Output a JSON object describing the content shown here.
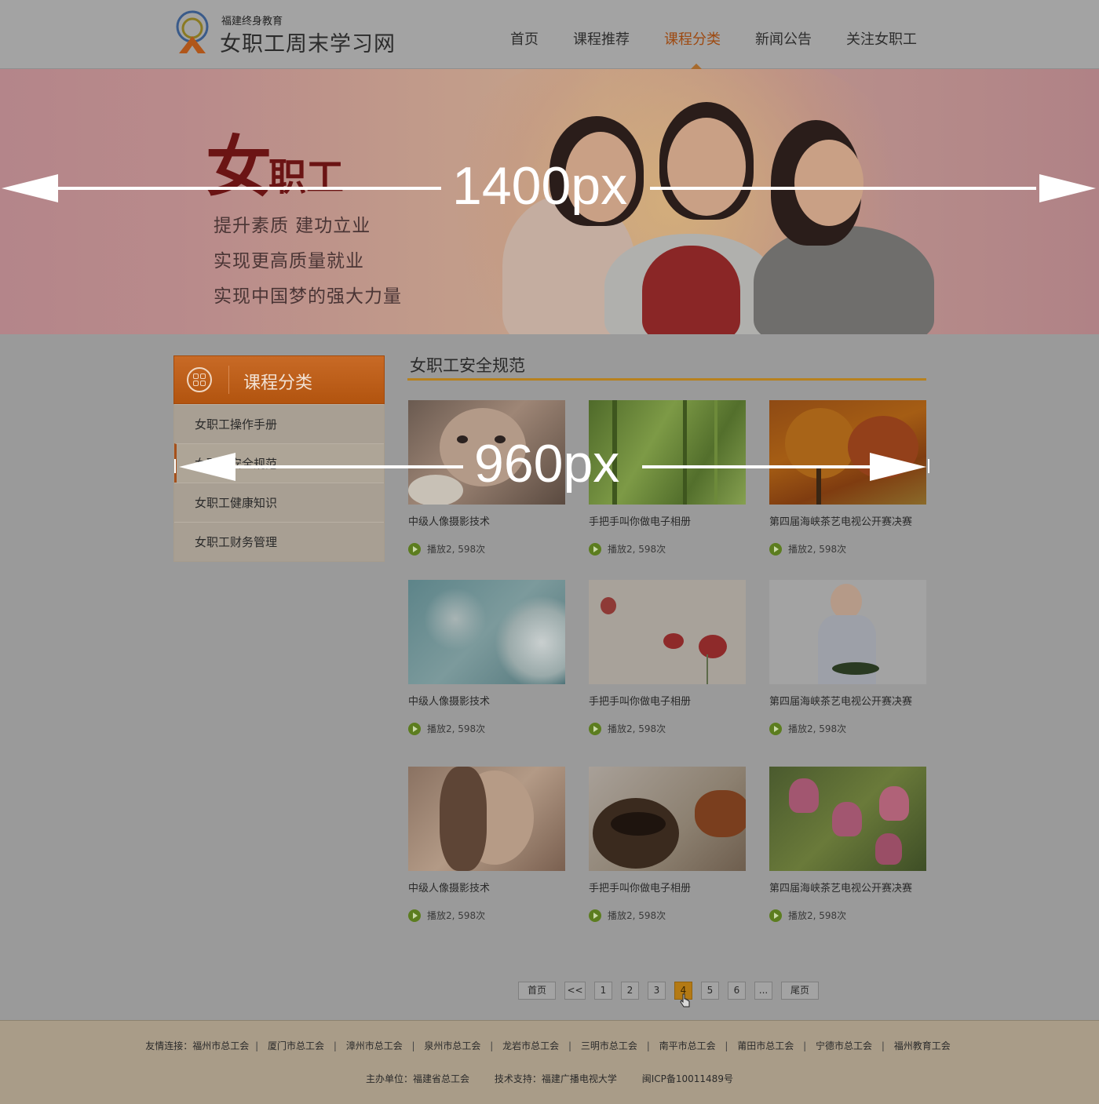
{
  "header": {
    "logo_sub": "福建终身教育",
    "logo_title": "女职工周末学习网",
    "nav": [
      {
        "label": "首页",
        "active": false
      },
      {
        "label": "课程推荐",
        "active": false
      },
      {
        "label": "课程分类",
        "active": true
      },
      {
        "label": "新闻公告",
        "active": false
      },
      {
        "label": "关注女职工",
        "active": false
      }
    ]
  },
  "banner": {
    "title_big": "女",
    "title_rest": "职工",
    "lines": [
      "提升素质 建功立业",
      "实现更高质量就业",
      "实现中国梦的强大力量"
    ]
  },
  "annotations": {
    "page_width_label": "1400px",
    "content_width_label": "960px"
  },
  "sidebar": {
    "title": "课程分类",
    "items": [
      {
        "label": "女职工操作手册",
        "active": false
      },
      {
        "label": "女职工安全规范",
        "active": true
      },
      {
        "label": "女职工健康知识",
        "active": false
      },
      {
        "label": "女职工财务管理",
        "active": false
      }
    ]
  },
  "main": {
    "section_title": "女职工安全规范",
    "cards": [
      {
        "title": "中级人像摄影技术",
        "plays": "播放2, 598次",
        "image": "portrait-girl-flowers"
      },
      {
        "title": "手把手叫你做电子相册",
        "plays": "播放2, 598次",
        "image": "green-willow"
      },
      {
        "title": "第四届海峡茶艺电视公开赛决赛",
        "plays": "播放2, 598次",
        "image": "autumn-trees"
      },
      {
        "title": "中级人像摄影技术",
        "plays": "播放2, 598次",
        "image": "dandelion"
      },
      {
        "title": "手把手叫你做电子相册",
        "plays": "播放2, 598次",
        "image": "red-poppies"
      },
      {
        "title": "第四届海峡茶艺电视公开赛决赛",
        "plays": "播放2, 598次",
        "image": "elderly-woman-cooking"
      },
      {
        "title": "中级人像摄影技术",
        "plays": "播放2, 598次",
        "image": "portrait-woman"
      },
      {
        "title": "手把手叫你做电子相册",
        "plays": "播放2, 598次",
        "image": "coffee-cup-teapot"
      },
      {
        "title": "第四届海峡茶艺电视公开赛决赛",
        "plays": "播放2, 598次",
        "image": "pink-bell-flowers"
      }
    ]
  },
  "pagination": {
    "first": "首页",
    "prev": "<<",
    "pages": [
      "1",
      "2",
      "3",
      "4",
      "5",
      "6"
    ],
    "current": "4",
    "ellipsis": "...",
    "last": "尾页"
  },
  "footer": {
    "links_prefix": "友情连接：",
    "links": [
      "福州市总工会",
      "厦门市总工会",
      "漳州市总工会",
      "泉州市总工会",
      "龙岩市总工会",
      "三明市总工会",
      "南平市总工会",
      "莆田市总工会",
      "宁德市总工会",
      "福州教育工会"
    ],
    "host": "主办单位：福建省总工会",
    "tech": "技术支持：福建广播电视大学",
    "icp": "闽ICP备10011489号"
  }
}
